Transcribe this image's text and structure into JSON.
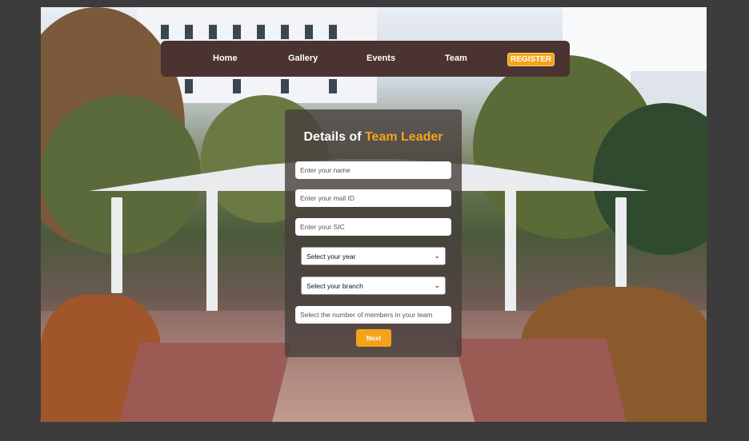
{
  "nav": {
    "home": "Home",
    "gallery": "Gallery",
    "events": "Events",
    "team": "Team",
    "register": "REGISTER"
  },
  "form": {
    "title_prefix": "Details of ",
    "title_highlight": "Team Leader",
    "name_placeholder": "Enter your name",
    "mail_placeholder": "Enter your mail ID",
    "sic_placeholder": "Enter your SIC",
    "year_select": "Select your year",
    "branch_select": "Select your branch",
    "members_placeholder": "Select the number of members in your team",
    "next_label": "Next"
  },
  "colors": {
    "accent": "#f5a31a",
    "navbar": "#4a3330",
    "page_bg": "#3c3c3c"
  }
}
